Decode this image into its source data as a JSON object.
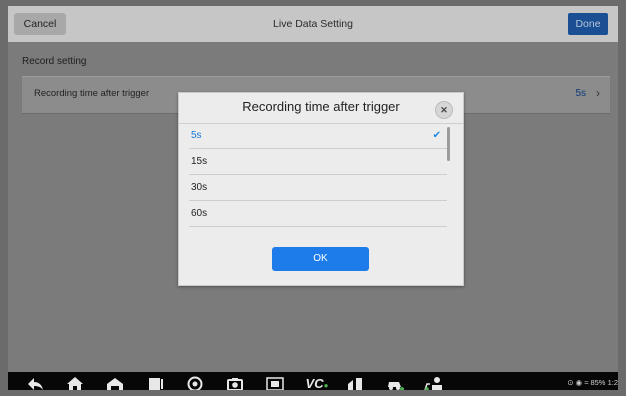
{
  "header": {
    "cancel_label": "Cancel",
    "title": "Live Data Setting",
    "done_label": "Done"
  },
  "section": {
    "title": "Record setting",
    "row_label": "Recording time after trigger",
    "row_value": "5s"
  },
  "dialog": {
    "title": "Recording time after trigger",
    "options": [
      "5s",
      "15s",
      "30s",
      "60s"
    ],
    "selected": "5s",
    "ok_label": "OK"
  },
  "navbar": {
    "icons": [
      "back-icon",
      "home-icon",
      "garage-icon",
      "recent-apps-icon",
      "browser-icon",
      "camera-icon",
      "screenshot-icon",
      "vci-icon",
      "vehicle-info-icon",
      "car-icon",
      "remote-expert-icon"
    ],
    "vci_text": "VC",
    "status_text": "85% 1:2"
  },
  "colors": {
    "accent": "#1d7ce9",
    "selected_text": "#1478d8",
    "done_button": "#1a4f93"
  }
}
